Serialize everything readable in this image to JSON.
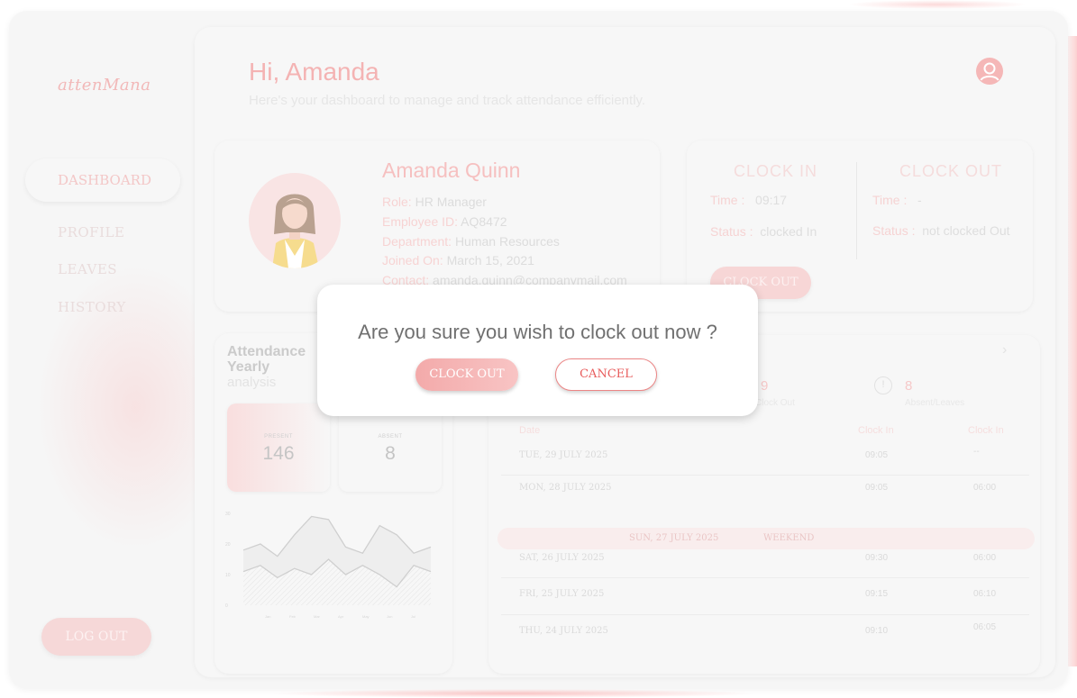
{
  "app": {
    "logo": "attenMana"
  },
  "sidebar": {
    "items": [
      {
        "label": "DASHBOARD",
        "active": true
      },
      {
        "label": "PROFILE"
      },
      {
        "label": "LEAVES"
      },
      {
        "label": "HISTORY"
      }
    ],
    "logout_label": "LOG OUT"
  },
  "header": {
    "greeting": "Hi, Amanda",
    "subtitle": "Here's your dashboard to manage and track attendance efficiently."
  },
  "profile": {
    "name": "Amanda Quinn",
    "fields": [
      {
        "key": "Role:",
        "value": "HR Manager"
      },
      {
        "key": "Employee ID:",
        "value": "AQ8472"
      },
      {
        "key": "Department:",
        "value": "Human Resources"
      },
      {
        "key": "Joined On:",
        "value": "March 15, 2021"
      },
      {
        "key": "Contact:",
        "value": "amanda.quinn@companymail.com"
      }
    ]
  },
  "clock": {
    "in": {
      "title": "CLOCK IN",
      "time_label": "Time :",
      "time": "09:17",
      "status_label": "Status :",
      "status": "clocked In"
    },
    "out": {
      "title": "CLOCK OUT",
      "time_label": "Time :",
      "time": "-",
      "status_label": "Status :",
      "status": "not clocked Out"
    },
    "button_label": "CLOCK OUT"
  },
  "attendance": {
    "title_line1": "Attendance",
    "title_line2": "Yearly",
    "subtitle": "analysis",
    "present_label": "PRESENT",
    "present_value": "146",
    "absent_label": "ABSENT",
    "absent_value": "8",
    "chart_y_ticks": [
      "30",
      "20",
      "10",
      "0"
    ],
    "chart_x_ticks": [
      "Jan",
      "Feb",
      "Mar",
      "Apr",
      "May",
      "Jun",
      "Jul"
    ],
    "series_upper": [
      18,
      20,
      16,
      23,
      29,
      28,
      19,
      17,
      26,
      23,
      17,
      19
    ],
    "series_lower": [
      11,
      13,
      9,
      12,
      10,
      15,
      10,
      13,
      10,
      6,
      13,
      11
    ]
  },
  "history": {
    "chevron": "›",
    "stat_mid_value": "9",
    "stat_mid_label": "Clock Out",
    "stat_right_value": "8",
    "stat_right_label": "Absent/Leaves",
    "columns": {
      "date": "Date",
      "clock_in": "Clock In",
      "clock_out": "Clock In"
    },
    "rows": [
      {
        "date": "TUE, 29 JULY 2025",
        "in": "09:05",
        "out": "--"
      },
      {
        "date": "MON, 28 JULY 2025",
        "in": "09:05",
        "out": "06:00"
      },
      {
        "date": "SAT, 26 JULY 2025",
        "in": "09:30",
        "out": "06:00"
      },
      {
        "date": "FRI, 25 JULY 2025",
        "in": "09:15",
        "out": "06:10"
      },
      {
        "date": "THU, 24 JULY 2025",
        "in": "09:10",
        "out": "06:05"
      }
    ],
    "weekend": {
      "date": "SUN, 27 JULY 2025",
      "label": "WEEKEND"
    }
  },
  "modal": {
    "message": "Are you sure you wish to clock out now ?",
    "confirm_label": "CLOCK OUT",
    "cancel_label": "CANCEL"
  },
  "colors": {
    "accent": "#f4a8a8",
    "cancel": "#e85c5c"
  }
}
